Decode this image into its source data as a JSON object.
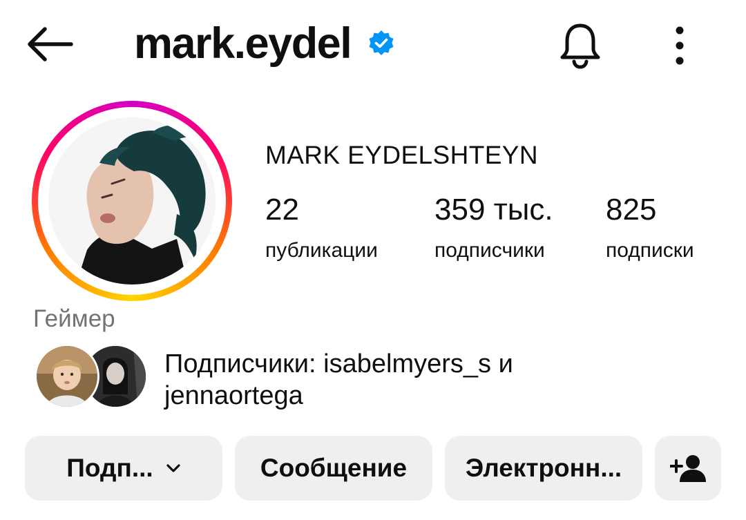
{
  "header": {
    "username": "mark.eydel",
    "verified": true,
    "icons": {
      "back": "arrow-left-icon",
      "verified": "verified-badge-icon",
      "notifications": "bell-icon",
      "more": "more-vertical-icon"
    },
    "verified_color": "#0095f6"
  },
  "profile": {
    "full_name": "MARK EYDELSHTEYN",
    "category": "Геймер",
    "stats": [
      {
        "value": "22",
        "label": "публикации"
      },
      {
        "value": "359 тыс.",
        "label": "подписчики"
      },
      {
        "value": "825",
        "label": "подписки"
      }
    ]
  },
  "followed_by": {
    "prefix": "Подписчики:",
    "users": [
      "isabelmyers_s",
      "jennaortega"
    ],
    "conjunction": "и"
  },
  "buttons": {
    "follow": "Подп...",
    "follow_icon": "chevron-down-icon",
    "message": "Сообщение",
    "email": "Электронн...",
    "add_user_icon": "add-user-icon"
  },
  "colors": {
    "text": "#0f0f0f",
    "secondary_text": "#737373",
    "button_bg": "#efefef",
    "story_ring": [
      "#ffd600",
      "#ff7a00",
      "#ff0169",
      "#d300c5"
    ]
  }
}
